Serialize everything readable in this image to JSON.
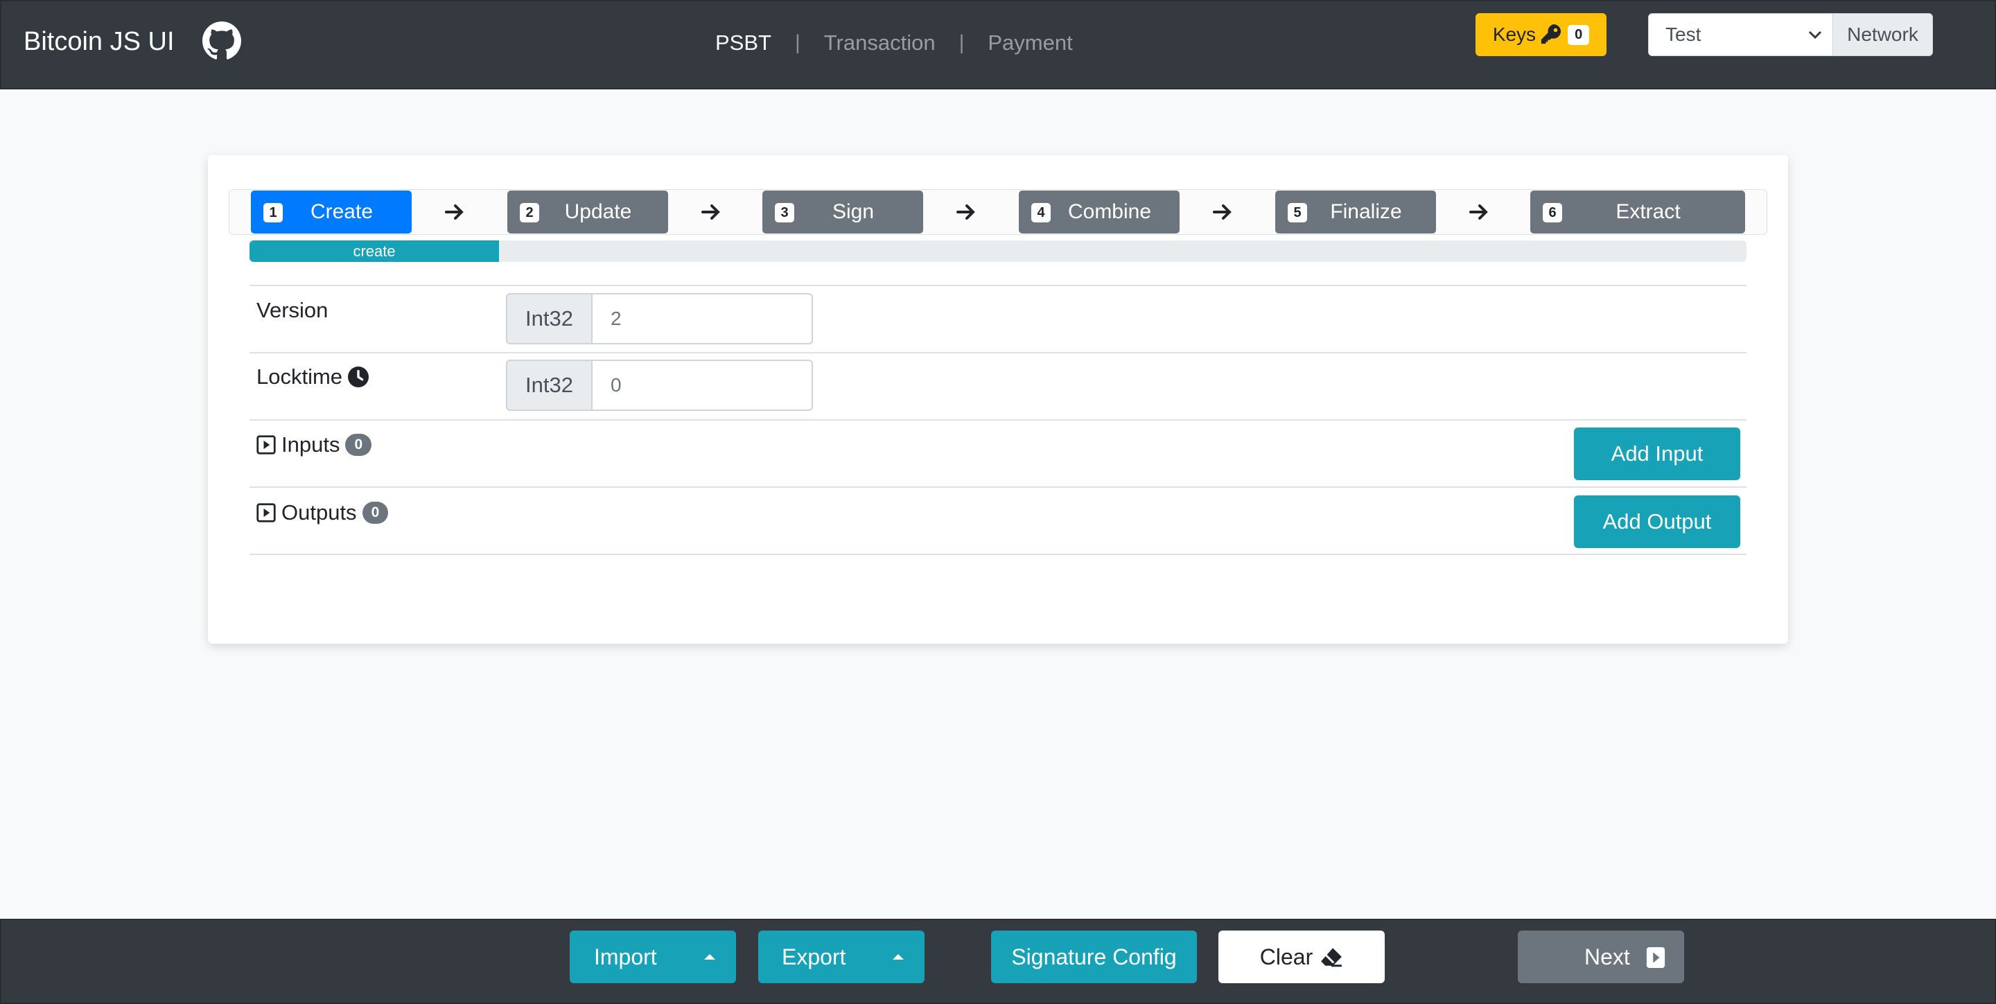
{
  "header": {
    "brand": "Bitcoin JS UI",
    "github_icon": "github-icon",
    "nav": [
      {
        "label": "PSBT",
        "active": true
      },
      {
        "label": "Transaction",
        "active": false
      },
      {
        "label": "Payment",
        "active": false
      }
    ],
    "nav_separator": "|",
    "keys_label": "Keys",
    "keys_icon": "key-icon",
    "keys_count": "0",
    "network_value": "Test",
    "network_addon": "Network"
  },
  "steps": [
    {
      "num": "1",
      "label": "Create",
      "active": true
    },
    {
      "num": "2",
      "label": "Update",
      "active": false
    },
    {
      "num": "3",
      "label": "Sign",
      "active": false
    },
    {
      "num": "4",
      "label": "Combine",
      "active": false
    },
    {
      "num": "5",
      "label": "Finalize",
      "active": false
    },
    {
      "num": "6",
      "label": "Extract",
      "active": false
    }
  ],
  "progress": {
    "label": "create",
    "fraction": 0.1667
  },
  "form": {
    "version": {
      "label": "Version",
      "type": "Int32",
      "value": "2"
    },
    "locktime": {
      "label": "Locktime",
      "type": "Int32",
      "value": "0",
      "icon": "clock-icon"
    },
    "inputs": {
      "label": "Inputs",
      "count": "0",
      "button": "Add Input"
    },
    "outputs": {
      "label": "Outputs",
      "count": "0",
      "button": "Add Output"
    }
  },
  "footer": {
    "import": "Import",
    "export": "Export",
    "signature_config": "Signature Config",
    "clear": "Clear",
    "clear_icon": "eraser-icon",
    "next": "Next",
    "next_icon": "caret-right-square-icon"
  },
  "colors": {
    "navbar": "#343a40",
    "primary": "#007bff",
    "secondary": "#6c757d",
    "info": "#17a2b8",
    "warning": "#ffc107"
  }
}
